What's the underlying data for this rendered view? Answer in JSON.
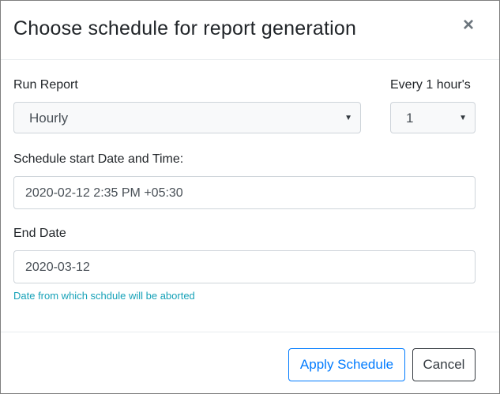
{
  "dialog": {
    "title": "Choose schedule for report generation",
    "close_symbol": "×",
    "close_icon": "close-icon"
  },
  "form": {
    "run_report": {
      "label": "Run Report",
      "selected": "Hourly",
      "caret": "▼"
    },
    "interval": {
      "label": "Every 1 hour's",
      "selected": "1",
      "caret": "▼"
    },
    "start": {
      "label": "Schedule start Date and Time:",
      "value": "2020-02-12 2:35 PM +05:30"
    },
    "end": {
      "label": "End Date",
      "value": "2020-03-12",
      "help": "Date from which schdule will be aborted"
    }
  },
  "footer": {
    "apply_label": "Apply Schedule",
    "cancel_label": "Cancel"
  },
  "colors": {
    "primary": "#007bff",
    "info": "#17a2b8",
    "dark": "#343a40"
  }
}
